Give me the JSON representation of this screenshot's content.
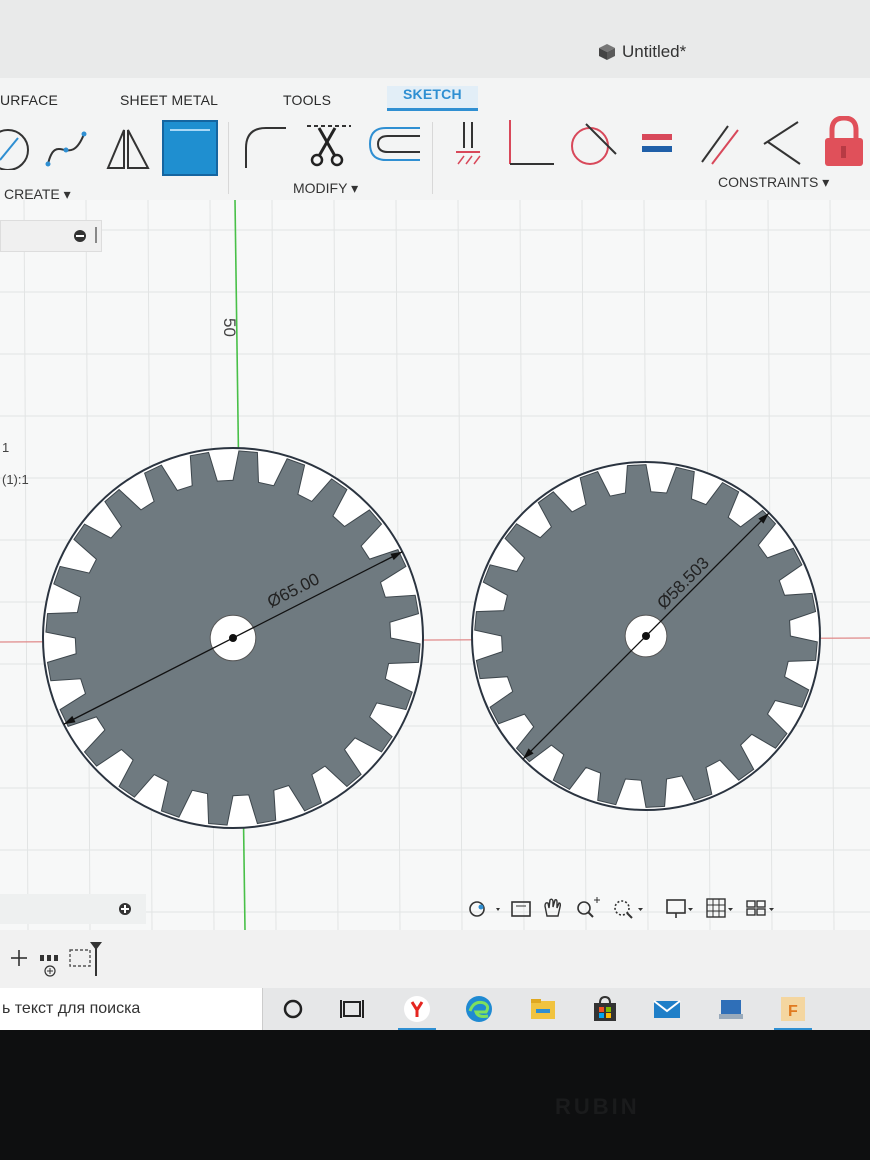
{
  "window": {
    "title": "Untitled*"
  },
  "ribbon": {
    "tabs": [
      {
        "label": "URFACE"
      },
      {
        "label": "SHEET METAL"
      },
      {
        "label": "TOOLS"
      },
      {
        "label": "SKETCH"
      }
    ],
    "groups": {
      "create": "CREATE ▾",
      "modify": "MODIFY ▾",
      "constraints": "CONSTRAINTS ▾"
    }
  },
  "canvas": {
    "axis_label": "50",
    "browser_items": [
      "1",
      "(1):1"
    ],
    "gears": [
      {
        "diameter_label": "Ø65.00",
        "teeth": 24
      },
      {
        "diameter_label": "Ø58.503",
        "teeth": 22
      }
    ]
  },
  "taskbar": {
    "search_text": "ь текст для поиска"
  },
  "monitor": {
    "brand": "RUBIN"
  },
  "colors": {
    "accent": "#2f8fd2",
    "gear_fill": "#6f7a80",
    "lock": "#e0505a",
    "grid": "#e2e4e4",
    "axis_green": "#48c048",
    "axis_red": "#e08a8a"
  }
}
